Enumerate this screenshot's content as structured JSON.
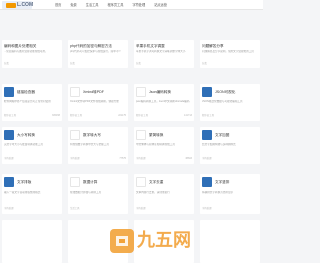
{
  "header": {
    "logo_text": "L.COM",
    "nav": [
      "首页",
      "免费",
      "生活工具",
      "程序员工具",
      "字符处理",
      "站点运营"
    ]
  },
  "cards_row1": [
    {
      "name": "编码和图片处理相关",
      "desc": "...常见编码与图片处理功能在线可用，",
      "meta": "分类",
      "count": ""
    },
    {
      "name": "php代码的加密与解密方法",
      "desc": "php代码可以加密保护与在线运行，简单不少",
      "meta": "分类",
      "count": ""
    },
    {
      "name": "苹果手机文字调整",
      "desc": "苹果手机字调可转换文字清晰调整字体大小",
      "meta": "分类",
      "count": ""
    },
    {
      "name": "问题解答分享",
      "desc": "问题解答及分享说明，常用文字处理类的工具",
      "meta": "分类",
      "count": ""
    }
  ],
  "cards_row2": [
    {
      "name": "链接检查器",
      "desc": "检查网站中各个链接是否可正常访问使用",
      "meta": "程序员工具",
      "count": "305458",
      "thumb": "#2f6fb7"
    },
    {
      "name": "Xmind转PDF",
      "desc": "Xmind文件转PDF文件在线转换，快捷方便",
      "meta": "程序员工具",
      "count": "221175",
      "thumb": "#ffffff"
    },
    {
      "name": "Json编码转换",
      "desc": "json编码转换工具，Json中文转换Unicode编码",
      "meta": "程序员工具",
      "count": "141713",
      "thumb": "#ffffff"
    },
    {
      "name": "JSON可视化",
      "desc": "JSON格式化数据与可视化编辑工具",
      "meta": "程序员工具",
      "count": "",
      "thumb": "#2f6fb7"
    }
  ],
  "cards_row3": [
    {
      "name": "大小写转换",
      "desc": "英文字母大小写批量转换功能工具",
      "meta": "字符处理",
      "count": "",
      "thumb": "#2f6fb7"
    },
    {
      "name": "数字转大写",
      "desc": "阿拉伯数字转换中文大写金额工具",
      "meta": "字符处理",
      "count": "77575",
      "thumb": "#ffffff"
    },
    {
      "name": "繁简转换",
      "desc": "中文繁体与简体互相转换在线工具",
      "meta": "字符处理",
      "count": "38603",
      "thumb": "#ffffff"
    },
    {
      "name": "文字加圈",
      "desc": "给文字加圈特效与多种圈样式",
      "meta": "字符处理",
      "count": "",
      "thumb": "#2f6fb7"
    }
  ],
  "cards_row4": [
    {
      "name": "文字排版",
      "desc": "输入一段文字自动排版整理格式",
      "meta": "字符处理",
      "count": "",
      "thumb": "#2f6fb7"
    },
    {
      "name": "数据计算",
      "desc": "在线数据计算器与转换工具",
      "meta": "生活工具",
      "count": "",
      "thumb": "#ffffff"
    },
    {
      "name": "文字去重",
      "desc": "文本内容行去重，清理重复行",
      "meta": "字符处理",
      "count": "",
      "thumb": "#ffffff"
    },
    {
      "name": "文字竖排",
      "desc": "将横排文字转换为竖排显示",
      "meta": "字符处理",
      "count": "",
      "thumb": "#2f6fb7"
    }
  ],
  "watermark": {
    "text": "九五网"
  },
  "colors": {
    "accent": "#2f6fb7",
    "logo_badge": "#f39800",
    "watermark": "#f2a33a"
  }
}
